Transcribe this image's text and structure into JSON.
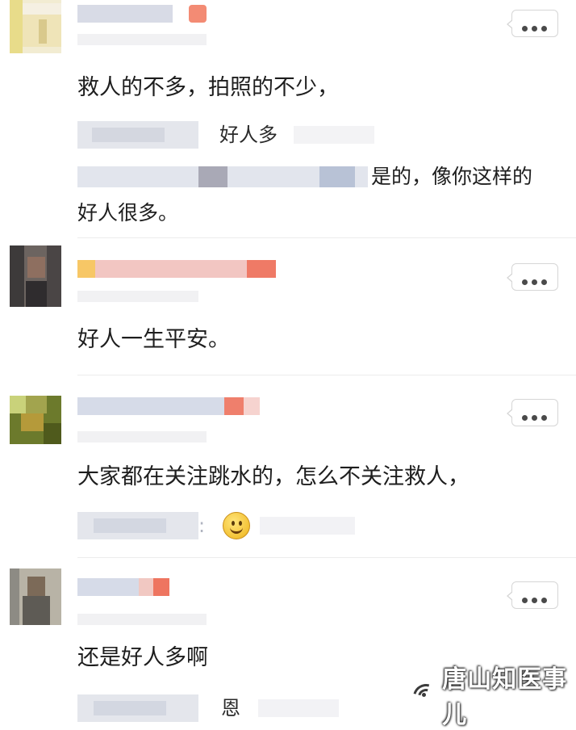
{
  "comments": [
    {
      "text": "救人的不多，拍照的不少，",
      "replies": [
        {
          "text": "好人多"
        },
        {
          "text": "是的，像你这样的好人很多。"
        }
      ]
    },
    {
      "text": "好人一生平安。"
    },
    {
      "text": "大家都在关注跳水的，怎么不关注救人，",
      "replies": [
        {
          "text": ":"
        }
      ]
    },
    {
      "text": "还是好人多啊",
      "replies": [
        {
          "text": "恩"
        }
      ]
    }
  ],
  "more_button_icon": "more-dots-icon",
  "reaction_emoji": "smiley-face-icon",
  "watermark": {
    "text": "唐山知医事儿"
  },
  "colors": {
    "accent": "#f06a5e",
    "text": "#1e1e1e",
    "divider": "#ececec"
  }
}
